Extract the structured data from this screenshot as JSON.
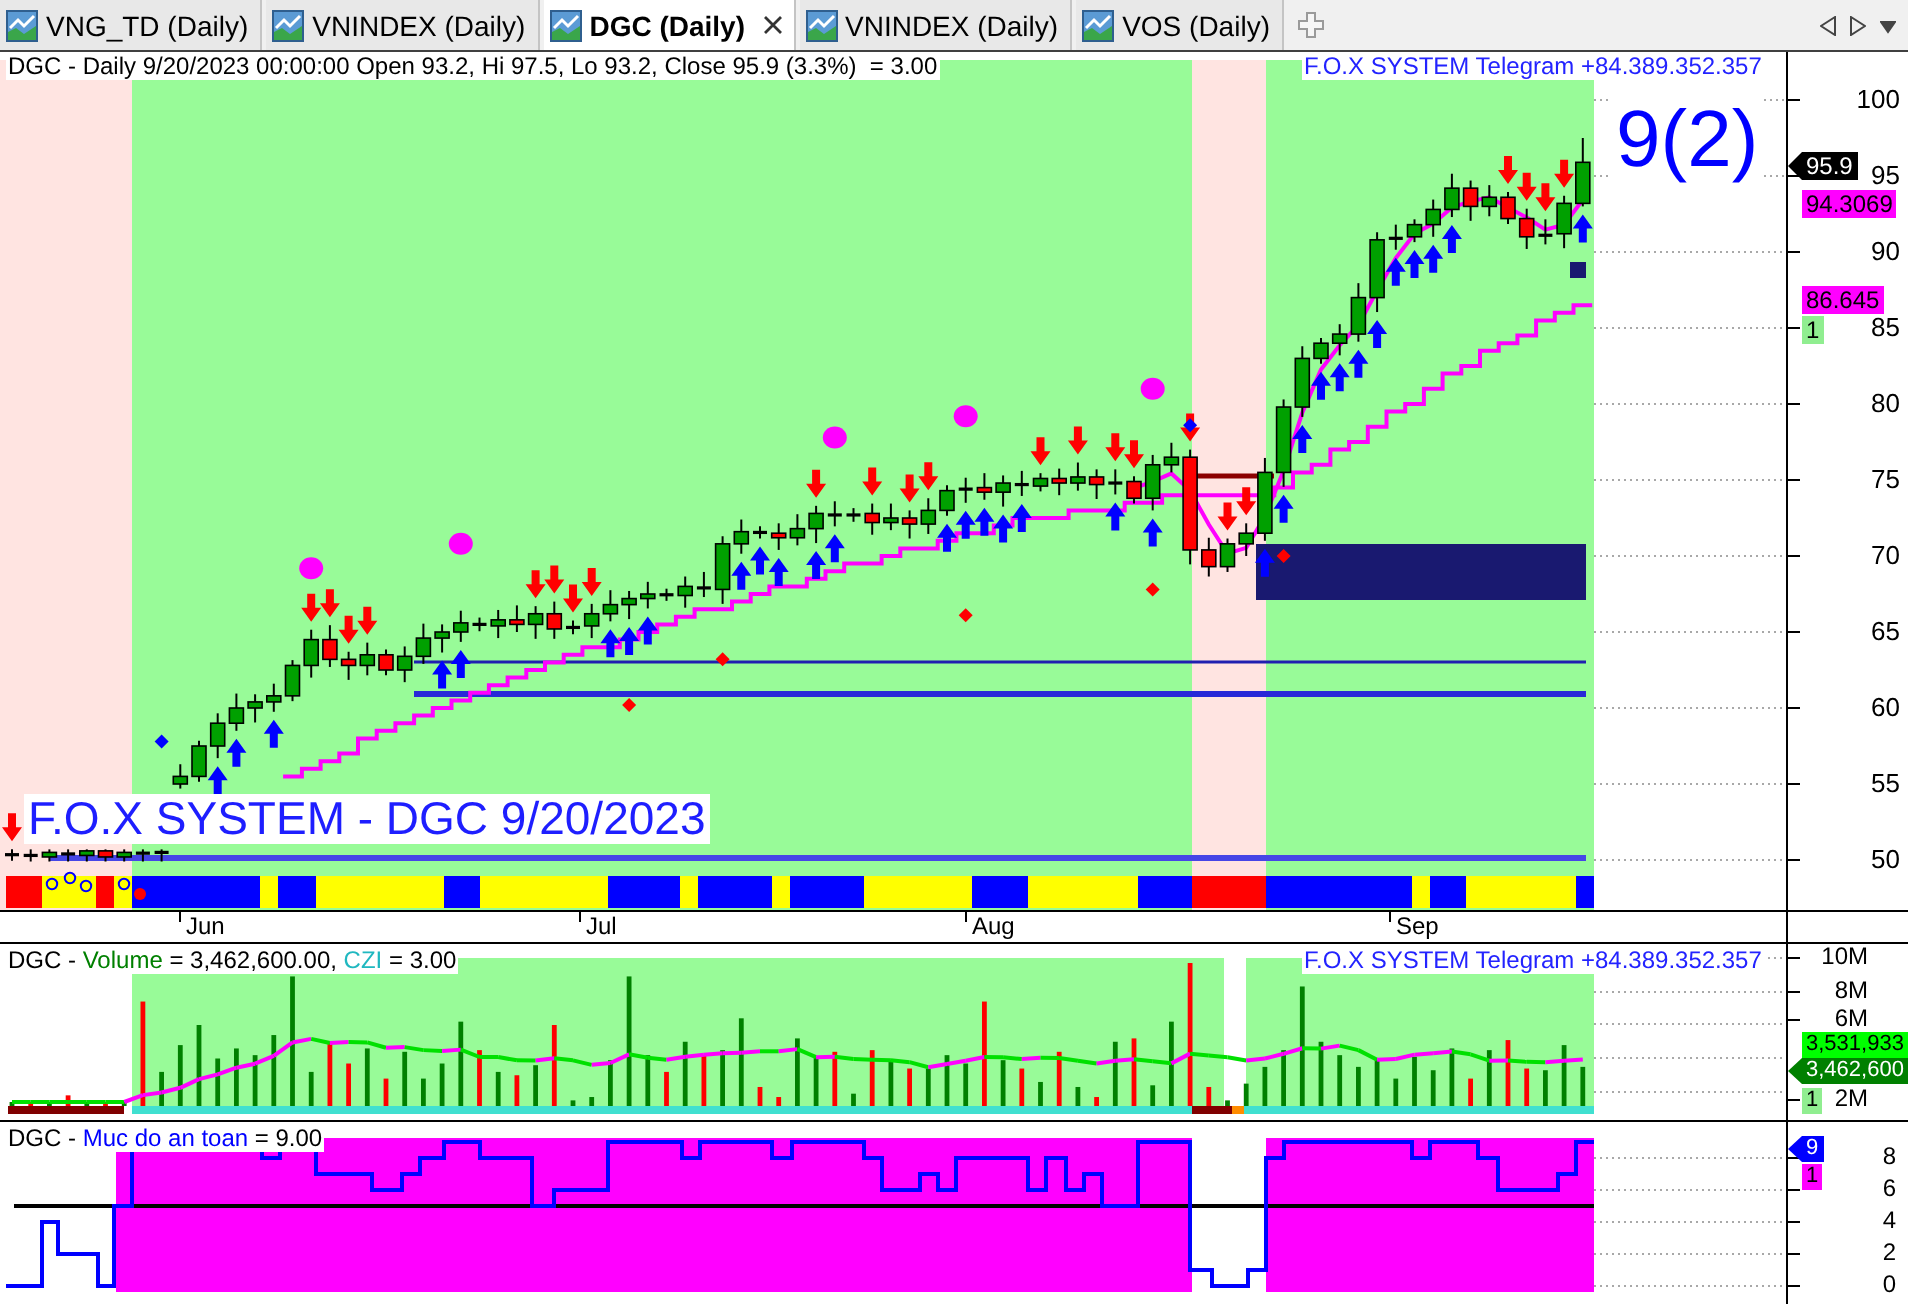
{
  "tabs": [
    {
      "label": "VNG_TD (Daily)",
      "selected": false
    },
    {
      "label": "VNINDEX (Daily)",
      "selected": false
    },
    {
      "label": "DGC (Daily)",
      "selected": true
    },
    {
      "label": "VNINDEX (Daily)",
      "selected": false
    },
    {
      "label": "VOS (Daily)",
      "selected": false
    }
  ],
  "price_pane": {
    "header": "DGC - Daily 9/20/2023 00:00:00 Open 93.2, Hi 97.5, Lo 93.2, Close 95.9 (3.3%)  = 3.00",
    "contact": "F.O.X SYSTEM Telegram +84.389.352.357",
    "signal_count": "9(2)",
    "chart_title": "F.O.X SYSTEM - DGC 9/20/2023",
    "y_axis_labels": [
      "100",
      "95",
      "90",
      "85",
      "80",
      "75",
      "70",
      "65",
      "60",
      "55",
      "50"
    ],
    "x_axis_labels": [
      "Jun",
      "Jul",
      "Aug",
      "Sep"
    ],
    "value_tags": [
      {
        "text": "95.9",
        "kind": "pointer",
        "color": "#000000"
      },
      {
        "text": "94.3069",
        "kind": "box",
        "color": "#ff00ff"
      },
      {
        "text": "86.645",
        "kind": "box",
        "color": "#ff00ff"
      },
      {
        "text": "1",
        "kind": "box",
        "color": "#90ee90"
      }
    ]
  },
  "volume_pane": {
    "header": [
      {
        "text": "DGC - ",
        "kind": "plain"
      },
      {
        "text": "Volume",
        "kind": "volume"
      },
      {
        "text": " = 3,462,600.00, ",
        "kind": "plain"
      },
      {
        "text": "CZI",
        "kind": "indicator"
      },
      {
        "text": " = 3.00",
        "kind": "plain"
      }
    ],
    "contact": "F.O.X SYSTEM Telegram +84.389.352.357",
    "y_axis_labels": [
      "10M",
      "8M",
      "6M",
      "2M"
    ],
    "value_tags": [
      {
        "text": "3,531,933",
        "kind": "box",
        "color": "#00ff00"
      },
      {
        "text": "3,462,600",
        "kind": "pointer",
        "color": "#008000"
      },
      {
        "text": "1",
        "kind": "box",
        "color": "#90ee90"
      }
    ]
  },
  "safety_pane": {
    "header": [
      {
        "text": "DGC - ",
        "kind": "plain"
      },
      {
        "text": "Muc do an toan",
        "kind": "series"
      },
      {
        "text": " = 9.00",
        "kind": "plain"
      }
    ],
    "y_axis_labels": [
      "8",
      "6",
      "4",
      "2",
      "0"
    ],
    "value_tags": [
      {
        "text": "9",
        "kind": "pointer",
        "color": "#0000ff"
      },
      {
        "text": "1",
        "kind": "box",
        "color": "#ff00ff"
      }
    ]
  }
}
